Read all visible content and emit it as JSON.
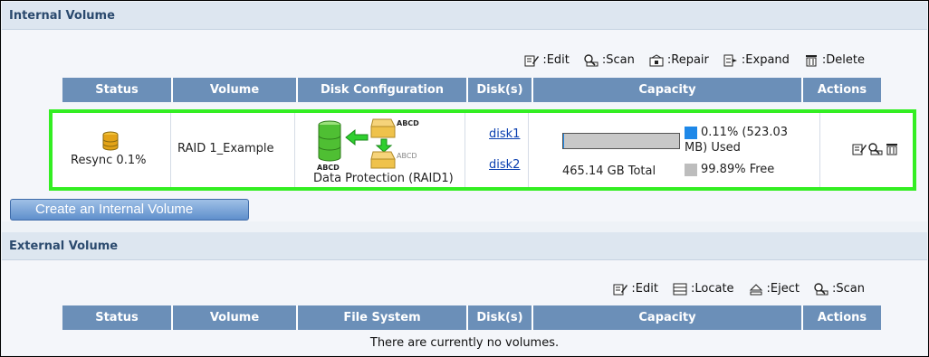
{
  "internal": {
    "title": "Internal Volume",
    "legend": {
      "edit": ":Edit",
      "scan": ":Scan",
      "repair": ":Repair",
      "expand": ":Expand",
      "delete": ":Delete"
    },
    "columns": [
      "Status",
      "Volume",
      "Disk Configuration",
      "Disk(s)",
      "Capacity",
      "Actions"
    ],
    "row": {
      "status": "Resync 0.1%",
      "volume": "RAID 1_Example",
      "disk_label": "ABCD",
      "config": "Data Protection (RAID1)",
      "disks": [
        "disk1",
        "disk2"
      ],
      "used_fraction": 0.0011,
      "used_line1": "0.11% (523.03",
      "used_line2": "MB) Used",
      "total": "465.14 GB Total",
      "free": "99.89% Free"
    },
    "create_button": "Create an Internal Volume"
  },
  "external": {
    "title": "External Volume",
    "legend": {
      "edit": ":Edit",
      "locate": ":Locate",
      "eject": ":Eject",
      "scan": ":Scan"
    },
    "columns": [
      "Status",
      "Volume",
      "File System",
      "Disk(s)",
      "Capacity",
      "Actions"
    ],
    "empty_message": "There are currently no volumes."
  },
  "colors": {
    "header": "#6b8fb8",
    "highlight": "#33ee22",
    "used": "#1e88e8",
    "free": "#bdbdbd"
  }
}
